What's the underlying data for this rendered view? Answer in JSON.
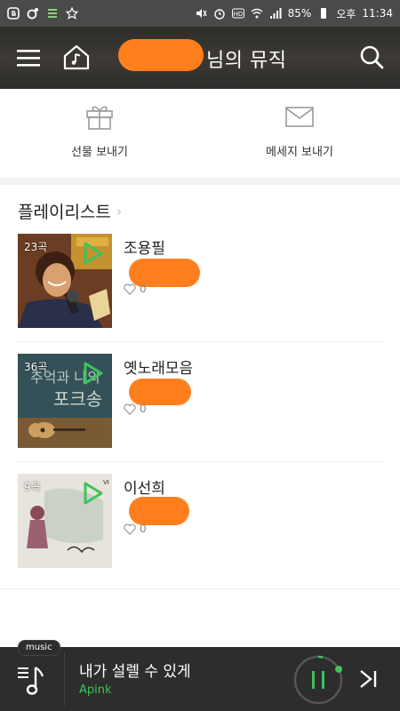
{
  "status_bar": {
    "battery": "85%",
    "ampm": "오후",
    "time": "11:34"
  },
  "header": {
    "title": "님의 뮤직"
  },
  "actions": {
    "gift_label": "선물 보내기",
    "message_label": "메세지 보내기"
  },
  "playlist_section": {
    "title": "플레이리스트",
    "items": [
      {
        "name": "조용필",
        "count": "23곡",
        "likes": "0"
      },
      {
        "name": "옛노래모음",
        "count": "36곡",
        "likes": "0"
      },
      {
        "name": "이선희",
        "count": "9곡",
        "likes": "0"
      }
    ]
  },
  "player": {
    "tag": "music",
    "song_title": "내가 설렐 수 있게",
    "artist": "Apink",
    "progress": 0.03
  },
  "colors": {
    "accent_green": "#3ec35a",
    "redaction_orange": "#ff7f1e",
    "player_bg": "#2d2d2d"
  }
}
